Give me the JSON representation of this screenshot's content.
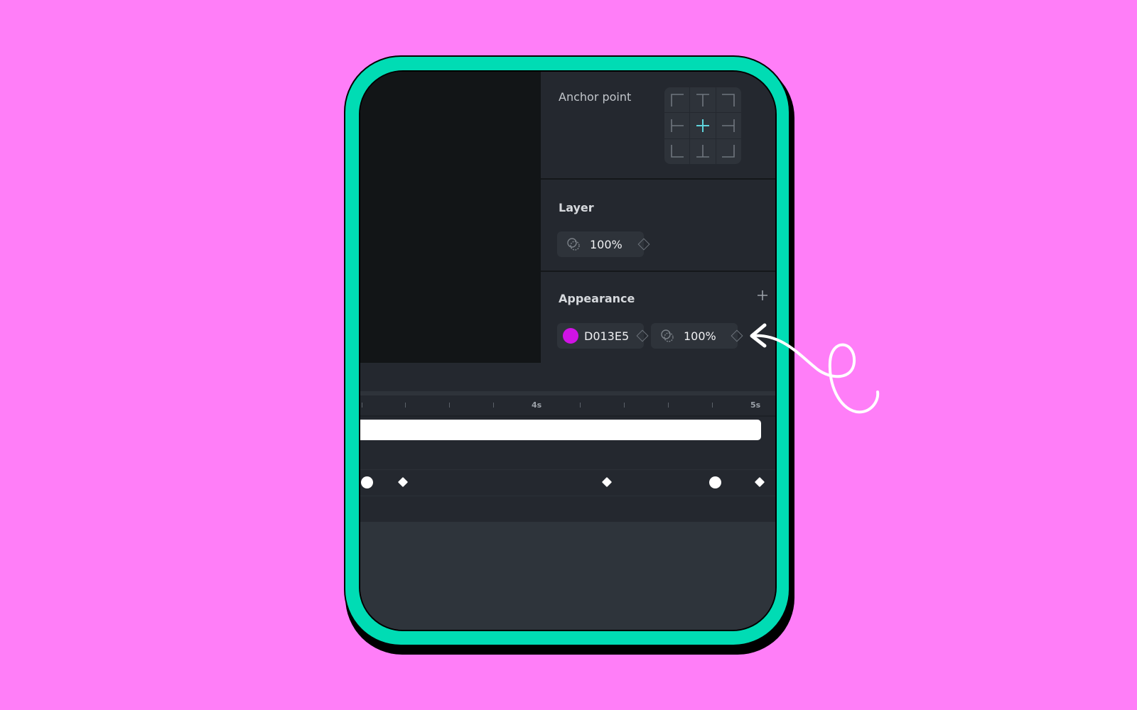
{
  "panel": {
    "anchor": {
      "title": "Anchor point",
      "cells": [
        {
          "name": "top-left",
          "selected": false
        },
        {
          "name": "top-center",
          "selected": false
        },
        {
          "name": "top-right",
          "selected": false
        },
        {
          "name": "middle-left",
          "selected": false
        },
        {
          "name": "center",
          "selected": true
        },
        {
          "name": "middle-right",
          "selected": false
        },
        {
          "name": "bottom-left",
          "selected": false
        },
        {
          "name": "bottom-center",
          "selected": false
        },
        {
          "name": "bottom-right",
          "selected": false
        }
      ]
    },
    "layer": {
      "title": "Layer",
      "opacity": "100%"
    },
    "appearance": {
      "title": "Appearance",
      "fill_hex": "D013E5",
      "fill_color": "#D013E5",
      "opacity": "100%"
    }
  },
  "timeline": {
    "labels": [
      "4s",
      "5s"
    ],
    "keyframes": [
      {
        "shape": "circle"
      },
      {
        "shape": "diamond"
      },
      {
        "shape": "diamond"
      },
      {
        "shape": "circle"
      },
      {
        "shape": "diamond"
      }
    ]
  },
  "colors": {
    "background": "#ff7ef8",
    "frame": "#00dcb4",
    "accent": "#5fd4dc"
  }
}
